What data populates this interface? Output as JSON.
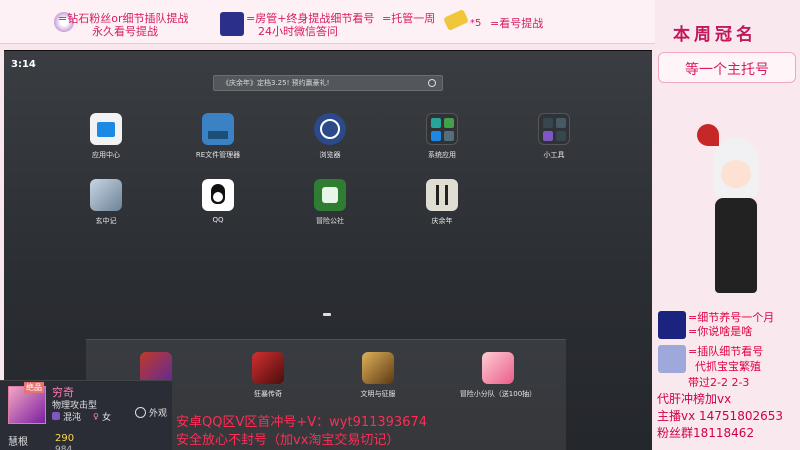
{
  "banner": {
    "seg1_line1": "=钻石粉丝or细节插队提战",
    "seg1_line2": "永久看号提战",
    "seg2_line1": "=房管+终身提战细节看号",
    "seg2_line2": "24小时微信答问",
    "seg3": "=托管一周",
    "seg4_count": "*5",
    "seg4_text": "=看号提战"
  },
  "phone": {
    "clock": "3:14",
    "search_text": "《庆余年》定档3.25! 预约赢豪礼!",
    "apps": [
      {
        "label": "应用中心",
        "icon": "app-store-icon",
        "color": "#f2f2f2"
      },
      {
        "label": "RE文件管理器",
        "icon": "re-file-manager-icon",
        "color": "#3b82c4"
      },
      {
        "label": "浏览器",
        "icon": "browser-compass-icon",
        "color": "#2b4a8a"
      },
      {
        "label": "系统应用",
        "icon": "system-apps-icon",
        "color": "#2f3338"
      },
      {
        "label": "小工具",
        "icon": "widgets-icon",
        "color": "#2f3338"
      },
      {
        "label": "玄中记",
        "icon": "xuanzhongji-game-icon",
        "color": "#8aa1b8"
      },
      {
        "label": "QQ",
        "icon": "qq-penguin-icon",
        "color": "#ffffff"
      },
      {
        "label": "冒险公社",
        "icon": "adventure-guild-icon",
        "color": "#2e7d32"
      },
      {
        "label": "庆余年",
        "icon": "qingyunian-game-icon",
        "color": "#e0ddd2"
      }
    ],
    "dock": [
      {
        "label": "",
        "icon": "dock-game-1-icon",
        "color": "#7a3fb0"
      },
      {
        "label": "狂暴传奇",
        "icon": "kuangbao-legend-icon",
        "color": "#8b1a1a"
      },
      {
        "label": "文明与征服",
        "icon": "civilization-conquest-icon",
        "color": "#9a6a2a"
      },
      {
        "label": "冒险小分队（送100抽）",
        "icon": "adventure-squad-icon",
        "color": "#e85d8a"
      }
    ]
  },
  "right": {
    "title": "本周冠名",
    "box": "等一个主托号",
    "note1": "=细节养号一个月",
    "note2": "=你说啥是啥",
    "note3": "=插队细节看号",
    "note4": "代抓宝宝繁殖",
    "note5": "带过2-2 2-3",
    "contact1": "代肝冲榜加vx",
    "contact2": "主播vx 14751802653",
    "contact3": "粉丝群18118462"
  },
  "card": {
    "badge": "绝品",
    "name": "穷奇",
    "type": "物理攻击型",
    "trait": "混沌",
    "gender": "女",
    "appearance": "外观",
    "stat_label": "慧根",
    "stat_value": "290",
    "stat2_value": "984"
  },
  "overlay": {
    "line1": "安卓QQ区V区首冲号+V：wyt911393674",
    "line2": "安全放心不封号（加vx淘宝交易切记）"
  }
}
